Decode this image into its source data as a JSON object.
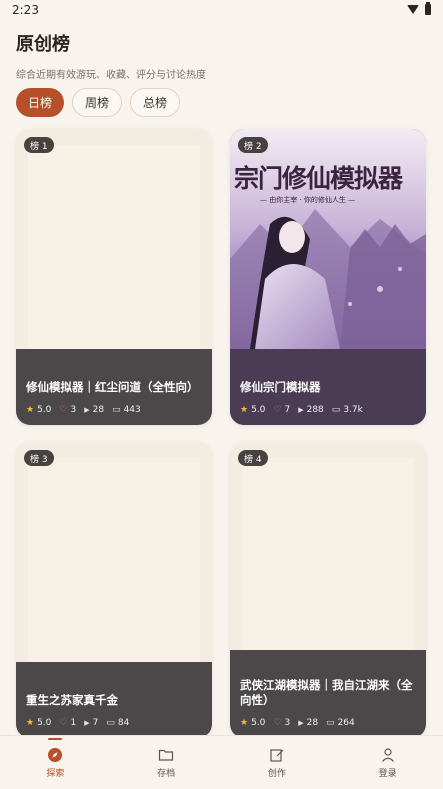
{
  "status": {
    "time": "2:23"
  },
  "header": {
    "title": "原创榜",
    "subtitle": "综合近期有效游玩、收藏、评分与讨论热度"
  },
  "tabs": [
    {
      "label": "日榜",
      "active": true
    },
    {
      "label": "周榜",
      "active": false
    },
    {
      "label": "总榜",
      "active": false
    }
  ],
  "cards": [
    {
      "rank": "榜 1",
      "title": "修仙模拟器｜红尘问道（全性向）",
      "rating": "5.0",
      "likes": "3",
      "plays": "28",
      "comments": "443"
    },
    {
      "rank": "榜 2",
      "title": "修仙宗门模拟器",
      "rating": "5.0",
      "likes": "7",
      "plays": "288",
      "comments": "3.7k",
      "cover_text": "宗门修仙模拟器",
      "cover_sub": "— 由你主宰 · 你的修仙人生 —"
    },
    {
      "rank": "榜 3",
      "title": "重生之苏家真千金",
      "rating": "5.0",
      "likes": "1",
      "plays": "7",
      "comments": "84"
    },
    {
      "rank": "榜 4",
      "title": "武侠江湖模拟器｜我自江湖来（全向性）",
      "rating": "5.0",
      "likes": "3",
      "plays": "28",
      "comments": "264"
    }
  ],
  "nav": [
    {
      "label": "探索",
      "icon": "compass-icon",
      "active": true
    },
    {
      "label": "存档",
      "icon": "folder-icon",
      "active": false
    },
    {
      "label": "创作",
      "icon": "edit-icon",
      "active": false
    },
    {
      "label": "登录",
      "icon": "user-icon",
      "active": false
    }
  ],
  "colors": {
    "accent": "#b7502a",
    "background": "#f8f3ec",
    "card_footer": "#4c4849"
  }
}
